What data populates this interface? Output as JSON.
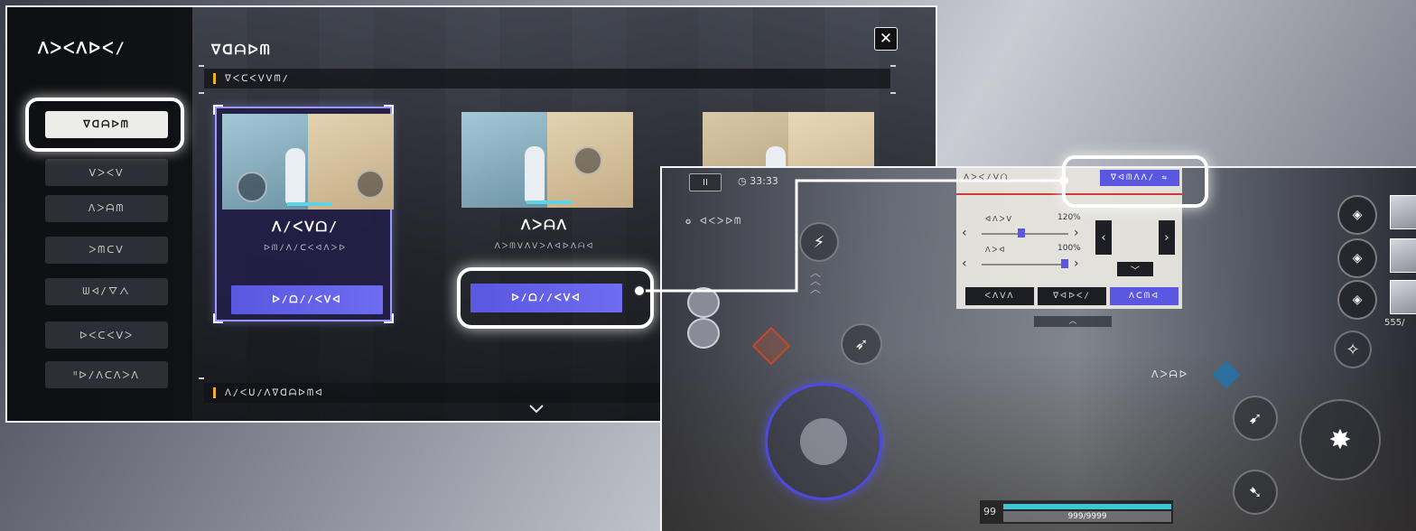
{
  "settings": {
    "sidebar_title": "ᐱᐳᐸᐱᐅᐸ/",
    "sidebar_items": [
      {
        "label": "ᐁᗡᗩᐅᗰ",
        "active": true
      },
      {
        "label": "ᐯᐳᐸᐯ",
        "active": false
      },
      {
        "label": "ᐱᐳᗩᗰ",
        "active": false
      },
      {
        "label": "ᐳᗰᑕᐯ",
        "active": false
      },
      {
        "label": "ᗯᐊ/ᐁᐱ",
        "active": false
      },
      {
        "label": "ᐅᐸᑕᐸᐯᐳ",
        "active": false
      },
      {
        "label": "ᐦᐅ/ᐱᑕᐱᐳᐱ",
        "active": false
      }
    ],
    "panel_title": "ᐁᗡᗩᐅᗰ",
    "close_label": "✕",
    "section_label": "ᐁᐸᑕᐸᐯᐯᗰ/",
    "bottom_section_label": "ᐱ/ᐸᑌ/ᐱᐁᗡᗩᐅᗰᐊ",
    "cards": [
      {
        "title": "ᐱ/ᐸᐯᗝ/",
        "subtitle": "ᐅᗰ/ᐱ/ᑕᐸᐊᐱᐳᐅ",
        "button": "ᐅ/ᗝ//ᐸᐯᐊ",
        "selected": true
      },
      {
        "title": "ᐱᐳᗩᐱ",
        "subtitle": "ᐱᐳᗰᐯᐱᐯᐳᐱᐊᐅᐱᗩᐊ",
        "button": "ᐅ/ᗝ//ᐸᐯᐊ",
        "selected": false
      }
    ]
  },
  "battle": {
    "pause": "II",
    "timer": "33:33",
    "mission": "ᐊᐸᐳᐅᗰ",
    "element_label": "ᐱᐳᗩᐅ",
    "level": "99",
    "hp": "999/9999",
    "stamina": "555/",
    "popup": {
      "header": "ᐱᐳᐸ/ᐯᗝ",
      "reset_button": "ᐁᐊᗰᐱᐱ/ ⇋",
      "sliders": [
        {
          "label": "ᐊᐱᐳᐯ",
          "value": "120%",
          "fill": 0.45
        },
        {
          "label": "ᐱᐳᐊ",
          "value": "100%",
          "fill": 0.95
        }
      ],
      "tabs": [
        {
          "label": "ᐸᐱᐯᐱ",
          "active": false
        },
        {
          "label": "ᐁᐊᐅᐸ/",
          "active": false
        },
        {
          "label": "ᐱᑕᗰᐊ",
          "active": true
        }
      ]
    }
  }
}
